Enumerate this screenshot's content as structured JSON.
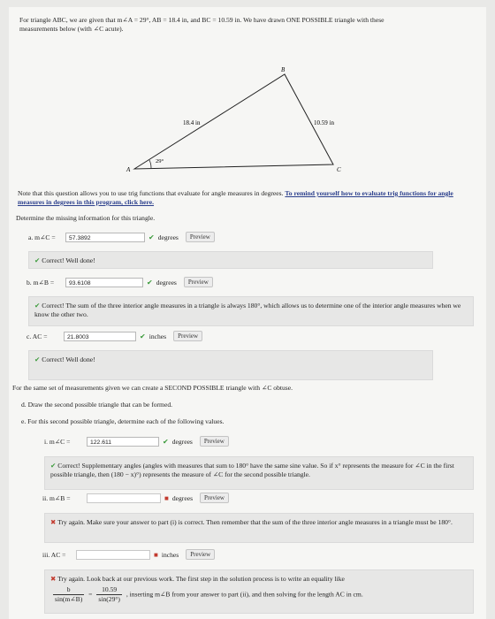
{
  "intro": {
    "line1": "For triangle ABC, we are given that m∠A = 29°, AB = 18.4 in, and BC = 10.59 in. We have drawn ONE POSSIBLE triangle with these",
    "line2": "measurements below (with ∠C acute)."
  },
  "triangle": {
    "vertex_a": "A",
    "vertex_b": "B",
    "vertex_c": "C",
    "side_ab": "18.4 in",
    "side_bc": "10.59 in",
    "angle_a": "29°"
  },
  "note": {
    "text": "Note that this question allows you to use trig functions that evaluate for angle measures in degrees. ",
    "link": "To remind yourself how to evaluate trig functions for angle measures in degrees in this program, click here."
  },
  "determine": "Determine the missing information for this triangle.",
  "q_a": {
    "label": "a. m∠C =",
    "value": "57.3892",
    "unit": "degrees",
    "preview": "Preview",
    "feedback": "Correct! Well done!"
  },
  "q_b": {
    "label": "b. m∠B =",
    "value": "93.6108",
    "unit": "degrees",
    "preview": "Preview",
    "feedback": "Correct! The sum of the three interior angle measures in a triangle is always 180°, which allows us to determine one of the interior angle measures when we know the other two."
  },
  "q_c": {
    "label": "c. AC =",
    "value": "21.8003",
    "unit": "inches",
    "preview": "Preview",
    "feedback": "Correct! Well done!"
  },
  "second": {
    "heading": "For the same set of measurements given we can create a SECOND POSSIBLE triangle with ∠C obtuse.",
    "d": "d. Draw the second possible triangle that can be formed.",
    "e": "e. For this second possible triangle, determine each of the following values."
  },
  "q_i": {
    "label": "i. m∠C =",
    "value": "122.611",
    "unit": "degrees",
    "preview": "Preview",
    "feedback": "Correct! Supplementary angles (angles with measures that sum to 180° have the same sine value. So if x° represents the measure for ∠C in the first possible triangle, then (180 − x)°) represents the measure of ∠C for the second possible triangle."
  },
  "q_ii": {
    "label": "ii. m∠B =",
    "value": "",
    "unit": "degrees",
    "preview": "Preview",
    "feedback": "Try again. Make sure your answer to part (i) is correct. Then remember that the sum of the three interior angle measures in a triangle must be 180°."
  },
  "q_iii": {
    "label": "iii. AC =",
    "value": "",
    "unit": "inches",
    "preview": "Preview",
    "feedback_start": "Try again. Look back at our previous work. The first step in the solution process is to write an equality like",
    "frac1_num": "b",
    "frac1_den": "sin(m∠B)",
    "equals": "=",
    "frac2_num": "10.59",
    "frac2_den": "sin(29°)",
    "feedback_end": ", inserting m∠B from your answer to part (ii), and then solving for the length AC in cm."
  }
}
